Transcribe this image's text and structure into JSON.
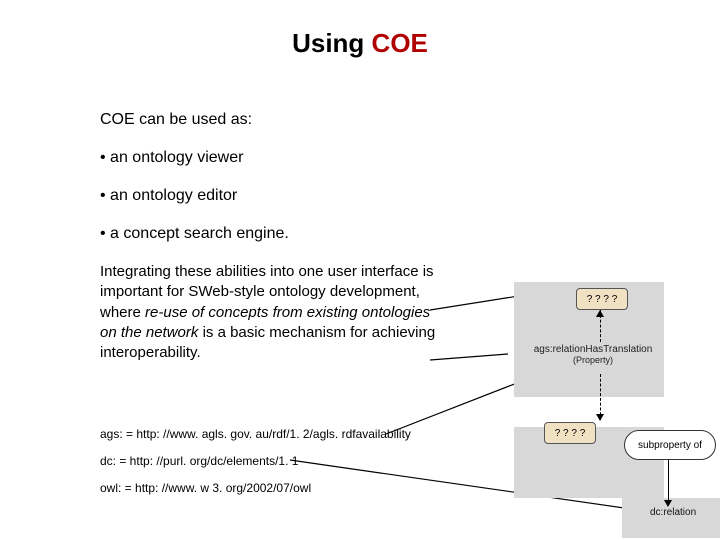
{
  "title": {
    "using": "Using ",
    "coe": "COE"
  },
  "intro": "COE can be used as:",
  "bullets": [
    "• an ontology viewer",
    "• an ontology editor",
    "• a concept search engine."
  ],
  "paragraph": {
    "lead": "Integrating these abilities into one user interface is important for SWeb-style ontology development, where ",
    "em": "re-use of concepts from existing ontologies on the network",
    "tail": " is a basic mechanism for achieving interoperability."
  },
  "prefixes": {
    "ags": "ags: = http: //www. agls. gov. au/rdf/1. 2/agls. rdfavailability",
    "dc": "dc: = http: //purl. org/dc/elements/1. 1",
    "owl": "owl: = http: //www. w 3. org/2002/07/owl"
  },
  "diagram": {
    "node_top": "? ? ? ?",
    "edge_label_line1": "ags:relationHasTranslation",
    "edge_label_line2": "(Property)",
    "node_bot": "? ? ? ?",
    "ellipse": "subproperty of",
    "dc_rel": "dc:relation"
  }
}
